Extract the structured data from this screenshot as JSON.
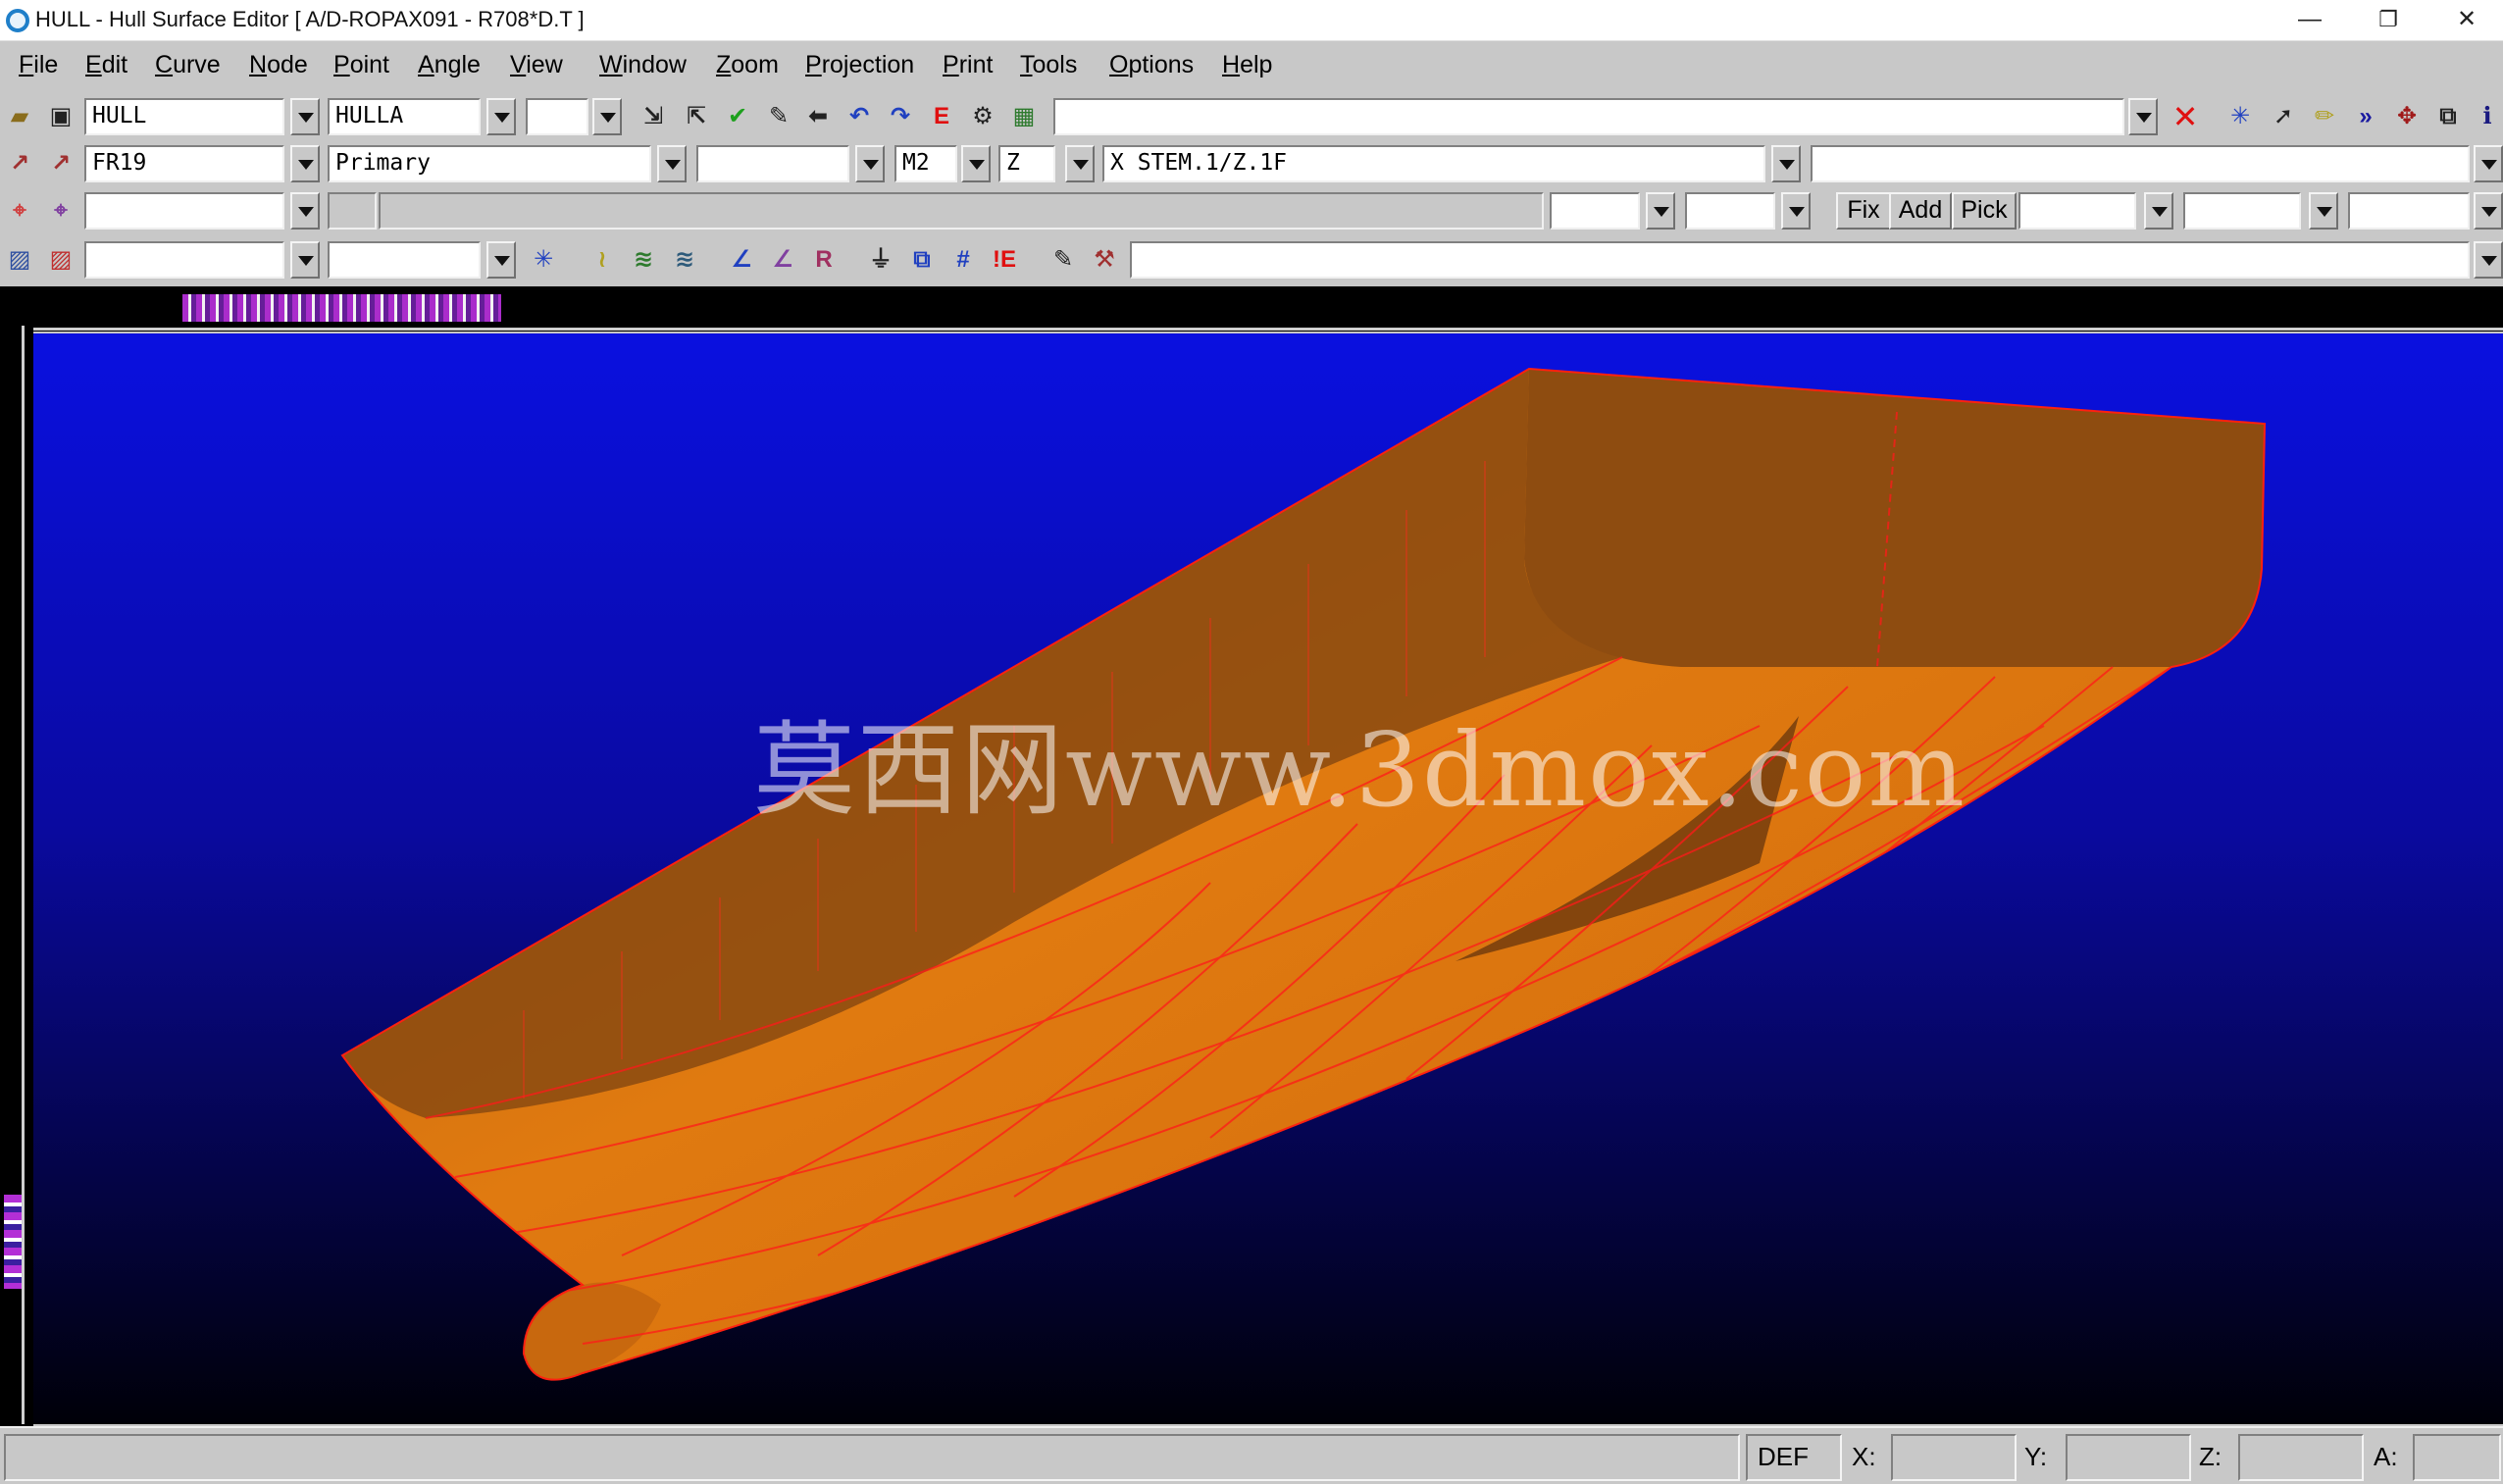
{
  "window": {
    "title": "HULL - Hull Surface Editor [ A/D-ROPAX091 - R708*D.T ]",
    "minimize_glyph": "—",
    "restore_glyph": "❐",
    "close_glyph": "✕"
  },
  "menu": [
    "File",
    "Edit",
    "Curve",
    "Node",
    "Point",
    "Angle",
    "View",
    "Window",
    "Zoom",
    "Projection",
    "Print",
    "Tools",
    "Options",
    "Help"
  ],
  "toolbar1": {
    "surface_field": "HULL",
    "surface2_field": "HULLA",
    "small_field": "",
    "long_field": ""
  },
  "toolbar2": {
    "curve_field": "FR19",
    "type_field": "Primary",
    "blank_field": "",
    "unit_field": "M2",
    "axis_field": "Z",
    "expr_field": "X STEM.1/Z.1F",
    "right_field": ""
  },
  "toolbar3": {
    "fix_label": "Fix",
    "add_label": "Add",
    "pick_label": "Pick"
  },
  "toolbar4": {
    "field1": "",
    "field2": "",
    "wide_field": ""
  },
  "canvas": {
    "background_top": "#0a10e0",
    "background_bottom": "#000008",
    "hull_color": "#e07a10",
    "hull_shadow": "#8a4a10",
    "mesh_color": "#ff1a1a",
    "watermark": "莫西网www.3dmox.com"
  },
  "statusbar": {
    "def_label": "DEF",
    "x_label": "X:",
    "y_label": "Y:",
    "z_label": "Z:",
    "a_label": "A:",
    "x_value": "",
    "y_value": "",
    "z_value": "",
    "a_value": ""
  }
}
